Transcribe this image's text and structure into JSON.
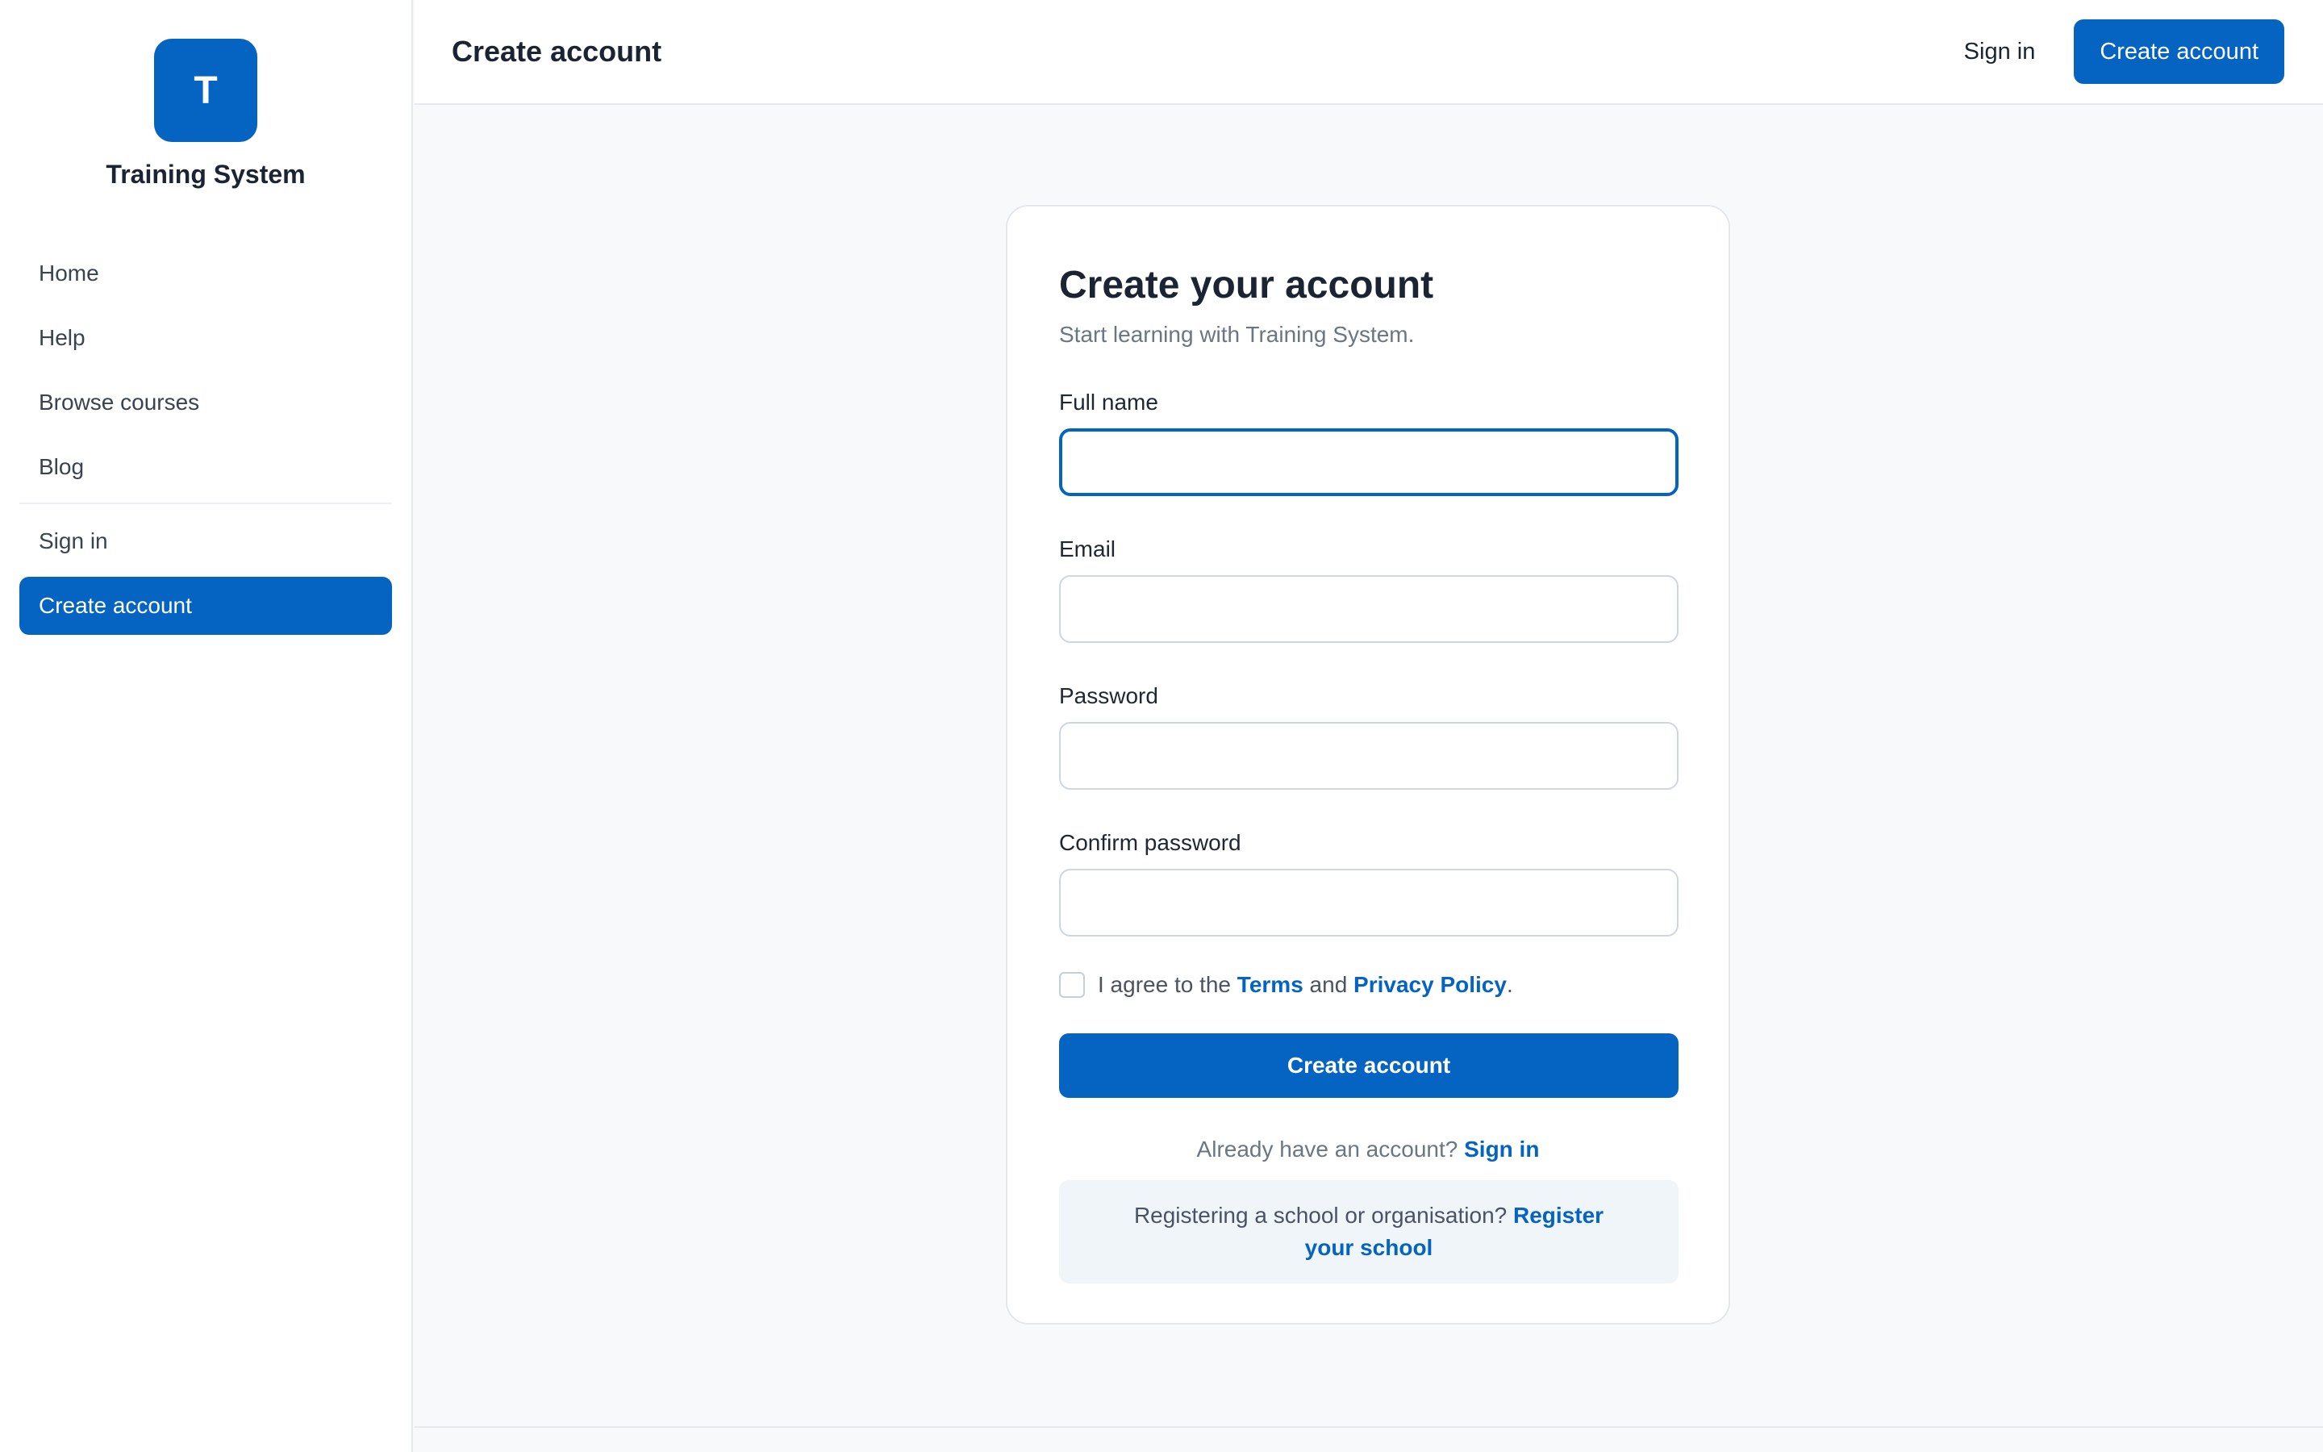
{
  "brand": {
    "logo_letter": "T",
    "name": "Training System"
  },
  "sidebar": {
    "items": [
      {
        "label": "Home"
      },
      {
        "label": "Help"
      },
      {
        "label": "Browse courses"
      },
      {
        "label": "Blog"
      }
    ],
    "account_items": [
      {
        "label": "Sign in"
      },
      {
        "label": "Create account",
        "active": true
      }
    ]
  },
  "topbar": {
    "title": "Create account",
    "signin_label": "Sign in",
    "create_label": "Create account"
  },
  "form": {
    "title": "Create your account",
    "subtitle": "Start learning with Training System.",
    "fields": [
      {
        "label": "Full name",
        "value": "",
        "placeholder": ""
      },
      {
        "label": "Email",
        "value": "",
        "placeholder": ""
      },
      {
        "label": "Password",
        "value": "",
        "placeholder": ""
      },
      {
        "label": "Confirm password",
        "value": "",
        "placeholder": ""
      }
    ],
    "agree": {
      "prefix": "I agree to the ",
      "terms": "Terms",
      "and": " and ",
      "privacy": "Privacy Policy",
      "suffix": ".",
      "checked": false
    },
    "submit_label": "Create account",
    "already": {
      "text": "Already have an account? ",
      "link": "Sign in"
    },
    "register": {
      "text": "Registering a school or organisation? ",
      "link": "Register your school"
    }
  },
  "colors": {
    "accent": "#0563c1",
    "background": "#f8f9fb"
  }
}
